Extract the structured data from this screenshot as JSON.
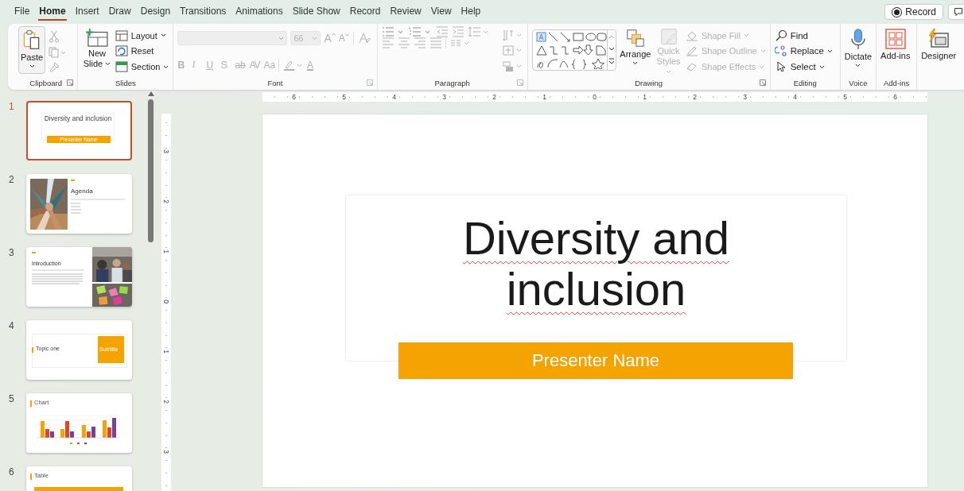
{
  "menu_tabs": [
    {
      "label": "File",
      "selected": false
    },
    {
      "label": "Home",
      "selected": true
    },
    {
      "label": "Insert",
      "selected": false
    },
    {
      "label": "Draw",
      "selected": false
    },
    {
      "label": "Design",
      "selected": false
    },
    {
      "label": "Transitions",
      "selected": false
    },
    {
      "label": "Animations",
      "selected": false
    },
    {
      "label": "Slide Show",
      "selected": false
    },
    {
      "label": "Record",
      "selected": false
    },
    {
      "label": "Review",
      "selected": false
    },
    {
      "label": "View",
      "selected": false
    },
    {
      "label": "Help",
      "selected": false
    }
  ],
  "record_button": {
    "label": "Record"
  },
  "ribbon": {
    "clipboard": {
      "label": "Clipboard",
      "paste": "Paste"
    },
    "slides": {
      "label": "Slides",
      "new_slide": "New Slide",
      "commands": [
        "Layout",
        "Reset",
        "Section"
      ]
    },
    "font": {
      "label": "Font",
      "disabled": true,
      "size": "66",
      "grow": "A",
      "shrink": "A",
      "format_buttons": [
        "B",
        "I",
        "U",
        "S",
        "ab",
        "AV",
        "Aa"
      ],
      "font_color": "A"
    },
    "paragraph": {
      "label": "Paragraph",
      "disabled": true
    },
    "drawing": {
      "label": "Drawing",
      "arrange": {
        "label": "Arrange",
        "disabled": false
      },
      "quick_styles": {
        "label": "Quick Styles",
        "disabled": true
      },
      "shape_commands": [
        {
          "label": "Shape Fill",
          "disabled": true
        },
        {
          "label": "Shape Outline",
          "disabled": true
        },
        {
          "label": "Shape Effects",
          "disabled": true
        }
      ]
    },
    "editing": {
      "label": "Editing",
      "commands": [
        "Find",
        "Replace",
        "Select"
      ]
    },
    "voice": {
      "label": "Voice",
      "dictate": "Dictate"
    },
    "addins": {
      "label": "Add-ins",
      "button": "Add-ins"
    },
    "designer": {
      "button": "Designer"
    }
  },
  "slides": [
    {
      "number": "1",
      "selected": true,
      "kind": "title",
      "title": "Diversity and inclusion",
      "subtitle": "Presenter Name"
    },
    {
      "number": "2",
      "selected": false,
      "kind": "agenda",
      "title": "Agenda"
    },
    {
      "number": "3",
      "selected": false,
      "kind": "introduction",
      "title": "Introduction"
    },
    {
      "number": "4",
      "selected": false,
      "kind": "section",
      "title": "Topic one",
      "subtitle": "Subtitle"
    },
    {
      "number": "5",
      "selected": false,
      "kind": "chart",
      "title": "Chart"
    },
    {
      "number": "6",
      "selected": false,
      "kind": "table",
      "title": "Table"
    }
  ],
  "ruler": {
    "horizontal": [
      "6",
      "5",
      "4",
      "3",
      "2",
      "1",
      "0",
      "1",
      "2",
      "3",
      "4",
      "5",
      "6"
    ],
    "vertical": [
      "3",
      "2",
      "1",
      "0",
      "1",
      "2",
      "3"
    ]
  },
  "slide": {
    "title": "Diversity and inclusion",
    "misspelled": true,
    "subtitle": "Presenter Name"
  }
}
